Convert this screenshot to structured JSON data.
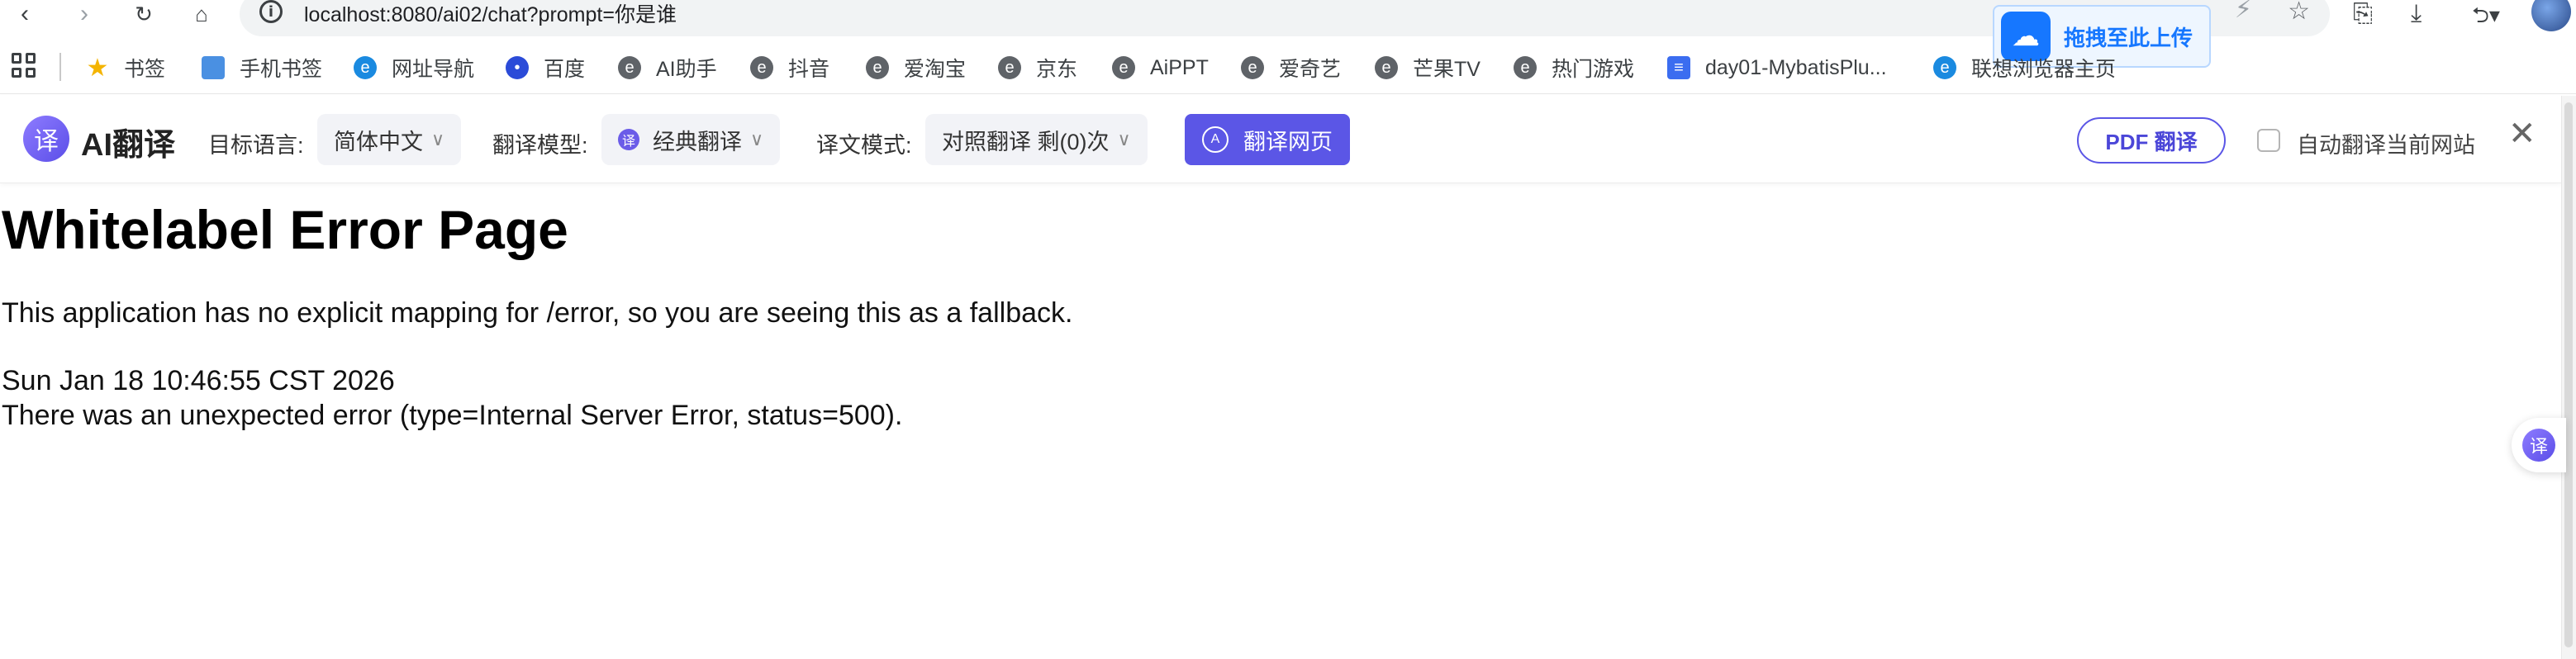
{
  "browser": {
    "url": "localhost:8080/ai02/chat?prompt=你是谁",
    "icons": {
      "back": "back-arrow-icon",
      "forward": "forward-arrow-icon",
      "reload": "reload-icon",
      "home": "home-icon",
      "info": "info-icon",
      "star": "star-icon"
    }
  },
  "upload_widget": {
    "label": "拖拽至此上传"
  },
  "bookmarks": [
    {
      "label": "书签",
      "icon": "star-icon"
    },
    {
      "label": "手机书签",
      "icon": "bookmark-icon"
    },
    {
      "label": "网址导航",
      "icon": "edge-icon"
    },
    {
      "label": "百度",
      "icon": "baidu-icon"
    },
    {
      "label": "AI助手",
      "icon": "edge-e-icon"
    },
    {
      "label": "抖音",
      "icon": "edge-e-icon"
    },
    {
      "label": "爱淘宝",
      "icon": "edge-e-icon"
    },
    {
      "label": "京东",
      "icon": "edge-e-icon"
    },
    {
      "label": "AiPPT",
      "icon": "edge-e-icon"
    },
    {
      "label": "爱奇艺",
      "icon": "edge-e-icon"
    },
    {
      "label": "芒果TV",
      "icon": "edge-e-icon"
    },
    {
      "label": "热门游戏",
      "icon": "edge-e-icon"
    },
    {
      "label": "day01-MybatisPlu...",
      "icon": "doc-icon"
    },
    {
      "label": "联想浏览器主页",
      "icon": "edge-icon"
    }
  ],
  "translate_bar": {
    "brand_logo": "译",
    "brand_name": "AI翻译",
    "target_lang_label": "目标语言:",
    "target_lang_value": "简体中文",
    "model_label": "翻译模型:",
    "model_value": "经典翻译",
    "mode_label": "译文模式:",
    "mode_value": "对照翻译 剩(0)次",
    "translate_button": "翻译网页",
    "pdf_button": "PDF 翻译",
    "auto_translate_label": "自动翻译当前网站",
    "auto_translate_checked": false,
    "accent_color": "#5b56e6"
  },
  "page": {
    "title": "Whitelabel Error Page",
    "description": "This application has no explicit mapping for /error, so you are seeing this as a fallback.",
    "timestamp": "Sun Jan 18 10:46:55 CST 2026",
    "error": "There was an unexpected error (type=Internal Server Error, status=500)."
  },
  "floating_button": {
    "label": "译"
  }
}
